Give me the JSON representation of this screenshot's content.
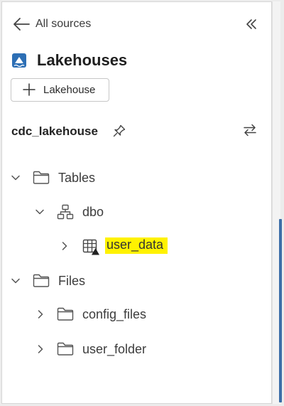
{
  "header": {
    "back_label": "All sources",
    "back_icon": "arrow-left-icon",
    "collapse_icon": "double-chevron-left-icon"
  },
  "section": {
    "title": "Lakehouses",
    "title_icon": "lakehouse-icon",
    "add_button_label": "Lakehouse",
    "add_button_icon": "plus-icon"
  },
  "lakehouse": {
    "name": "cdc_lakehouse",
    "pin_icon": "pin-icon",
    "switch_icon": "swap-arrows-icon"
  },
  "tree": {
    "tables": {
      "label": "Tables",
      "state": "expanded"
    },
    "dbo": {
      "label": "dbo",
      "state": "expanded"
    },
    "user_data": {
      "label": "user_data",
      "state": "collapsed",
      "highlighted": true
    },
    "files": {
      "label": "Files",
      "state": "expanded"
    },
    "config_files": {
      "label": "config_files",
      "state": "collapsed"
    },
    "user_folder": {
      "label": "user_folder",
      "state": "collapsed"
    }
  },
  "colors": {
    "highlight": "#fff200",
    "brand_blue": "#2d6fb5",
    "scrollbar_accent": "#3c6ea8"
  }
}
